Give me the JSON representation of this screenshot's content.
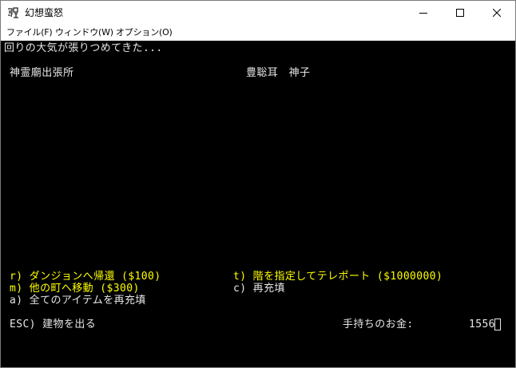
{
  "window": {
    "title": "幻想蛮怒",
    "controls": {
      "minimize": "minimize",
      "maximize": "maximize",
      "close": "close"
    }
  },
  "menu": {
    "items": [
      {
        "label": "ファイル(F)"
      },
      {
        "label": "ウィンドウ(W)"
      },
      {
        "label": "オプション(O)"
      }
    ]
  },
  "console": {
    "message": "回りの大気が張りつめてきた...",
    "location": "神霊廟出張所",
    "owner": "豊聡耳　神子",
    "options": {
      "r": "r) ダンジョンへ帰還 ($100)",
      "t": "t) 階を指定してテレポート ($1000000)",
      "m": "m) 他の町へ移動 ($300)",
      "c": "c) 再充填",
      "a": "a) 全てのアイテムを再充填"
    },
    "exit": "ESC) 建物を出る",
    "gold_label": "手持ちのお金:",
    "gold_value": "1556"
  },
  "colors": {
    "console_bg": "#000000",
    "text_white": "#e6e6e6",
    "text_yellow": "#ffff00"
  }
}
